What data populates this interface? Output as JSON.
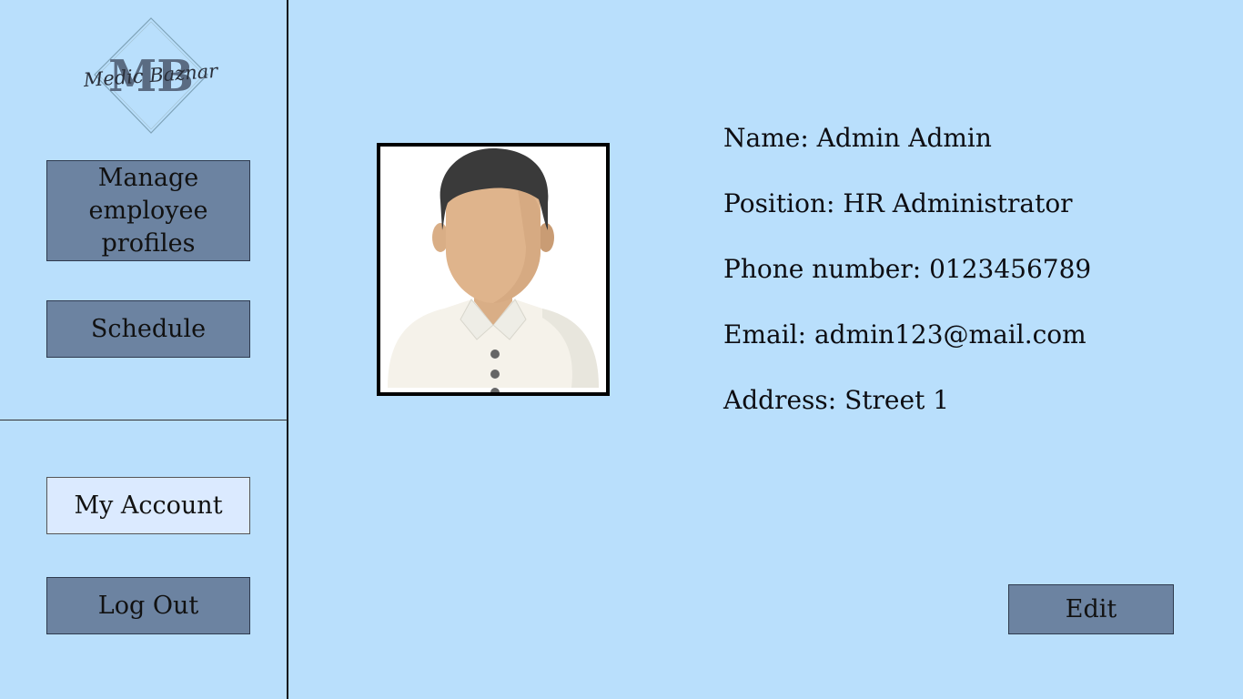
{
  "sidebar": {
    "logo": {
      "monogram": "MB",
      "script_text": "Medic Baznar"
    },
    "nav_items": [
      {
        "label": "Manage employee profiles"
      },
      {
        "label": "Schedule"
      }
    ],
    "bottom_items": [
      {
        "label": "My Account",
        "active": true
      },
      {
        "label": "Log Out"
      }
    ]
  },
  "profile": {
    "photo_icon": "user-avatar-icon",
    "fields": [
      {
        "label": "Name:",
        "value": "Admin Admin"
      },
      {
        "label": "Position:",
        "value": "HR Administrator"
      },
      {
        "label": "Phone number:",
        "value": "0123456789"
      },
      {
        "label": "Email:",
        "value": "admin123@mail.com"
      },
      {
        "label": "Address:",
        "value": "Street 1"
      }
    ]
  },
  "actions": {
    "edit_label": "Edit"
  },
  "colors": {
    "background": "#b9dffc",
    "button": "#6c83a1",
    "button_active": "#dbeaff"
  }
}
